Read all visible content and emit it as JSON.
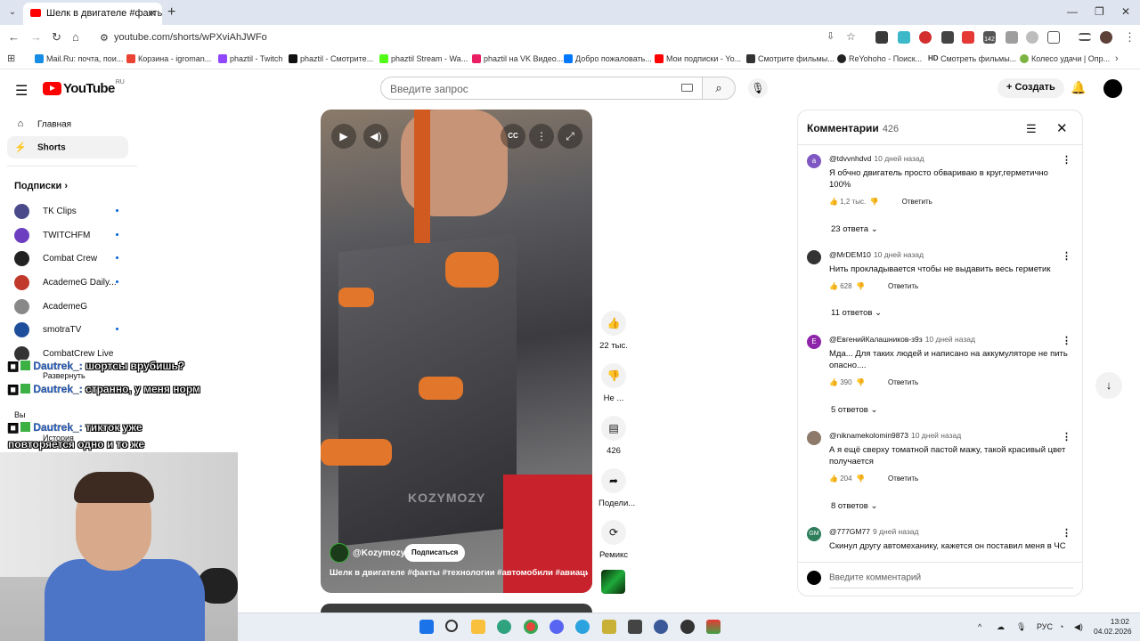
{
  "browser": {
    "tab_title": "Шелк в двигателе #факты",
    "url": "youtube.com/shorts/wPXviAhJWFo",
    "badge_count": "142",
    "bookmarks": [
      "Mail.Ru: почта, пои...",
      "Корзина - igroman...",
      "phaztil - Twitch",
      "phaztil - Смотрите...",
      "phaztil Stream - Wa...",
      "phaztil на VK Видео...",
      "Добро пожаловать...",
      "Мои подписки - Yo...",
      "Смотрите фильмы...",
      "ReYohoho - Поиск...",
      "Смотреть фильмы...",
      "Колесо удачи | Опр..."
    ],
    "bookmark_icon_hd": "HD"
  },
  "header": {
    "logo": "YouTube",
    "logo_region": "RU",
    "search_placeholder": "Введите запрос",
    "create_label": "Создать"
  },
  "sidebar": {
    "items": [
      {
        "label": "Главная"
      },
      {
        "label": "Shorts"
      }
    ],
    "subscriptions_label": "Подписки",
    "channels": [
      {
        "name": "TK Clips",
        "color": "#4a4a8a"
      },
      {
        "name": "TWITCHFM",
        "color": "#6d3fc0"
      },
      {
        "name": "Combat Crew",
        "color": "#222222"
      },
      {
        "name": "AcademeG Daily...",
        "color": "#c0392b"
      },
      {
        "name": "AcademeG",
        "color": "#888888"
      },
      {
        "name": "smotraTV",
        "color": "#1f4e9a"
      },
      {
        "name": "CombatCrew Live",
        "color": "#333333"
      }
    ],
    "expand_label": "Развернуть",
    "you_label": "Вы",
    "history_label": "История"
  },
  "chat_overlay": [
    {
      "user": "Dautrek_:",
      "text": "шортсы врубишь?"
    },
    {
      "user": "Dautrek_:",
      "text": "странно, у меня норм"
    },
    {
      "user": "Dautrek_:",
      "text": "тикток уже повторяется одно и то же"
    }
  ],
  "video": {
    "watermark": "KOZYMOZY",
    "channel": "@Kozymozy",
    "subscribe_label": "Подписаться",
    "title": "Шелк в двигателе #факты #технологии #автомобили #авиация",
    "cc_label": "CC"
  },
  "actions": {
    "likes": "22 тыс.",
    "dislike": "Не ...",
    "comments": "426",
    "share": "Подели...",
    "remix": "Ремикс"
  },
  "comments": {
    "title": "Комментарии",
    "count": "426",
    "reply_label": "Ответить",
    "items": [
      {
        "author": "@tdvvnhdvd",
        "time": "10 дней назад",
        "text": "Я обчно двигатель просто обвариваю в круг,герметично 100%",
        "likes": "1,2 тыс.",
        "replies": "23 ответа",
        "avatar_letter": "a",
        "avatar_color": "#7e57c2"
      },
      {
        "author": "@MrDEM10",
        "time": "10 дней назад",
        "text": "Нить прокладывается чтобы не выдавить весь герметик",
        "likes": "628",
        "replies": "11 ответов",
        "avatar_letter": "",
        "avatar_color": "#333333"
      },
      {
        "author": "@ЕвгенийКалашников-з9з",
        "time": "10 дней назад",
        "text": "Мда... Для таких людей и написано на аккумуляторе не пить опасно....",
        "likes": "390",
        "replies": "5 ответов",
        "avatar_letter": "E",
        "avatar_color": "#8e24aa"
      },
      {
        "author": "@niknamekolomin9873",
        "time": "10 дней назад",
        "text": "А я ещё сверху томатной пастой мажу, такой красивый цвет получается",
        "likes": "204",
        "replies": "8 ответов",
        "avatar_letter": "",
        "avatar_color": "#8d7a6a"
      },
      {
        "author": "@777GM77",
        "time": "9 дней назад",
        "text": "Скинул другу автомеханику, кажется он поставил меня в ЧС",
        "avatar_letter": "GM",
        "avatar_color": "#2e7d5b"
      }
    ],
    "input_placeholder": "Введите комментарий"
  },
  "taskbar": {
    "lang": "РУС",
    "time": "13:02",
    "date": "04.02.2026"
  }
}
